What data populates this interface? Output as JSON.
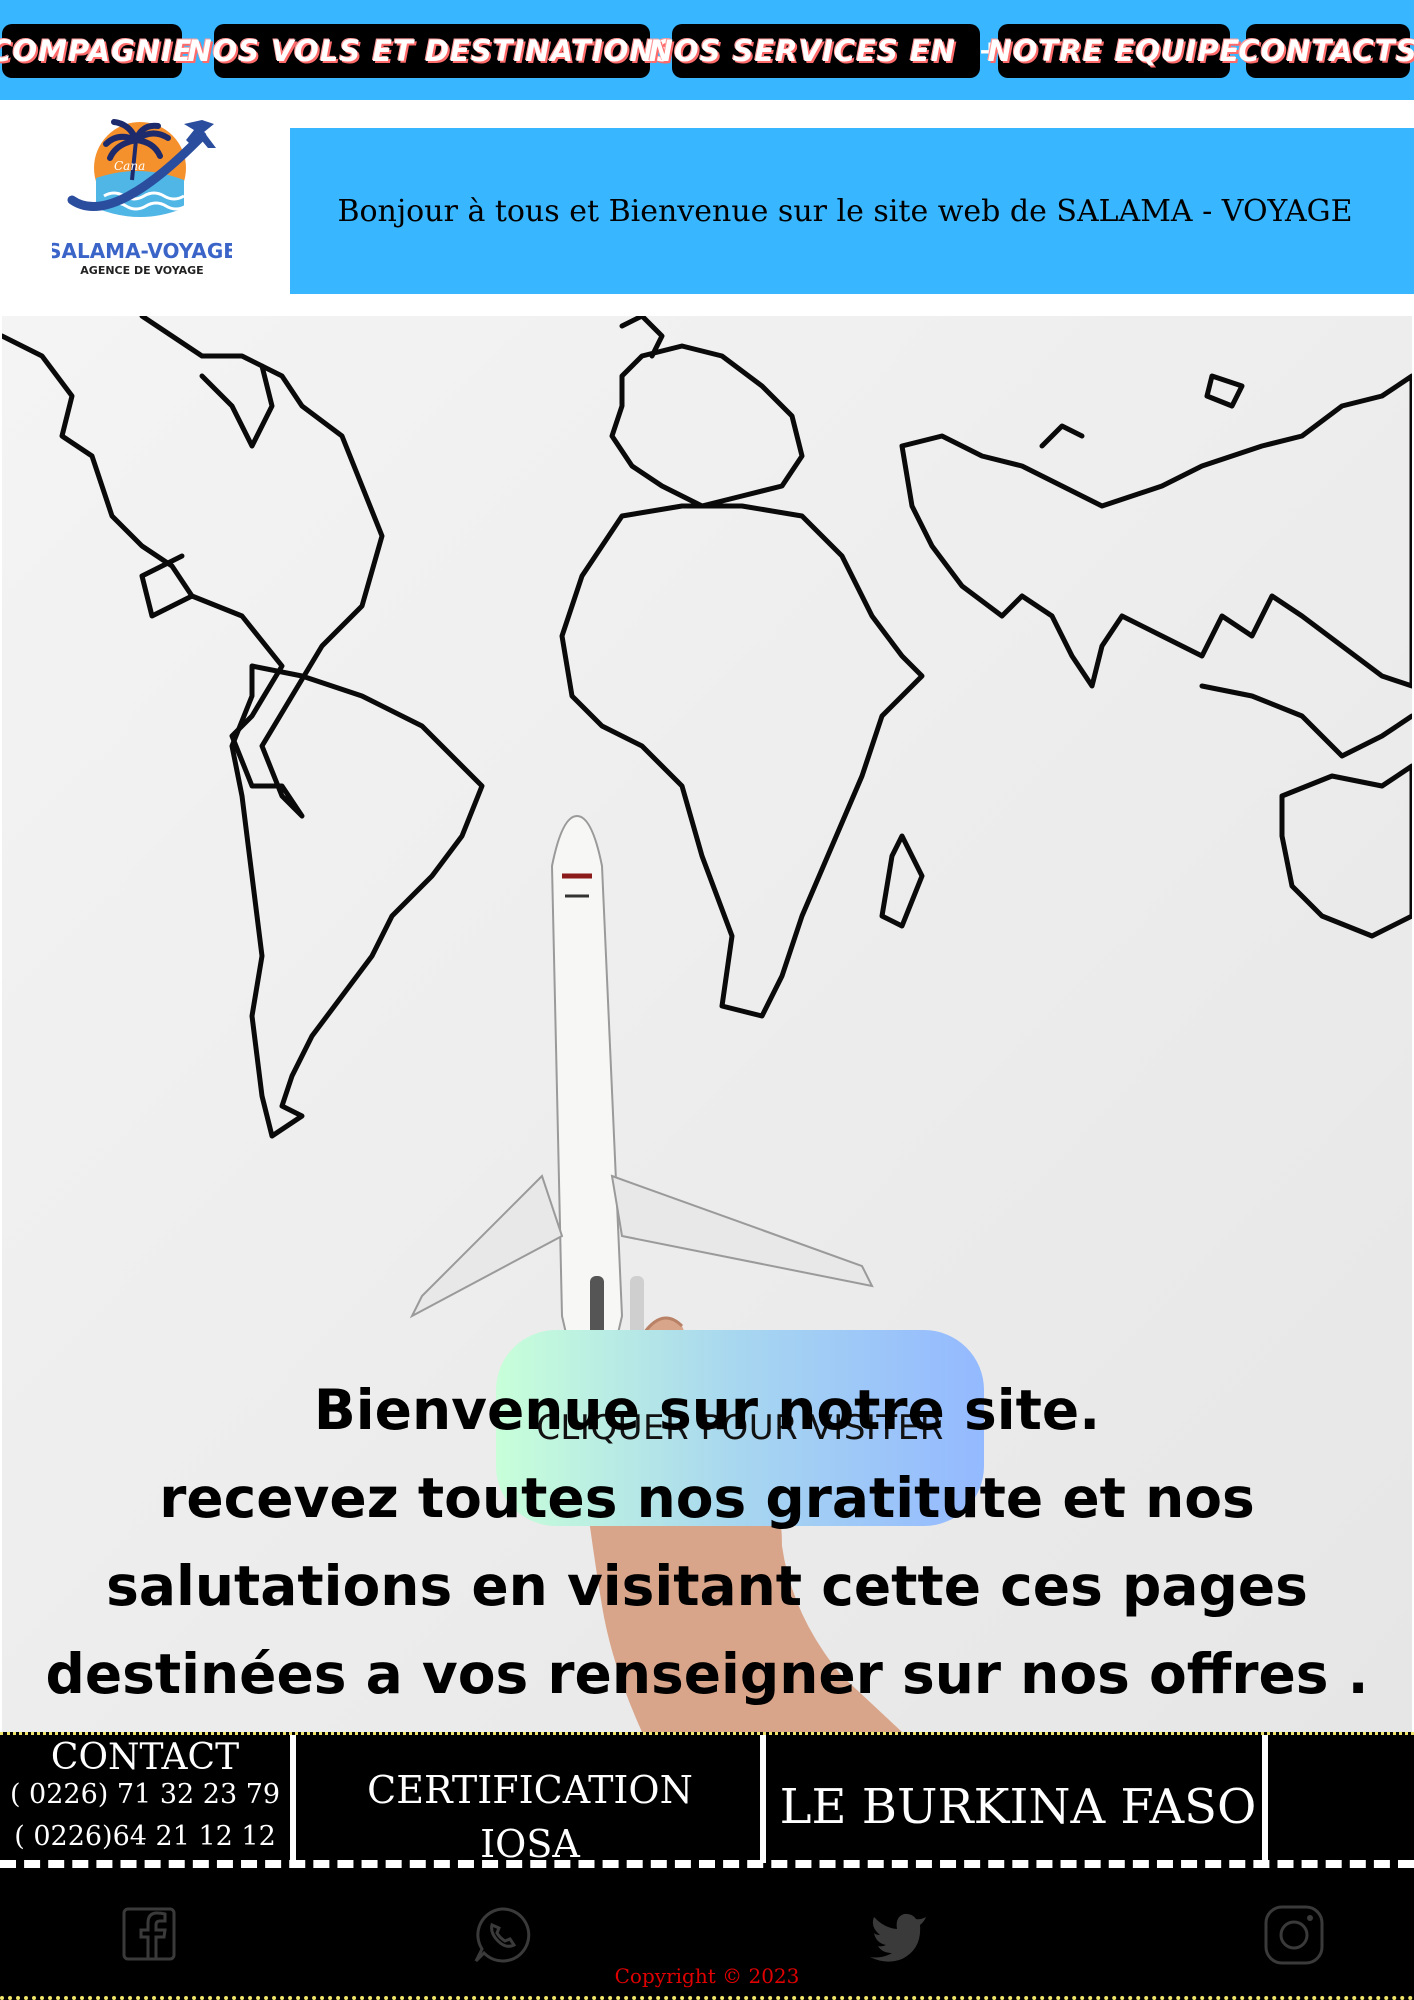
{
  "nav": {
    "items": [
      {
        "label": "Compagnie"
      },
      {
        "label": "Nos vols et destinations"
      },
      {
        "label": "Nos services en",
        "suffix": "+"
      },
      {
        "label": "Notre equipe"
      },
      {
        "label": "Contacts"
      }
    ]
  },
  "header": {
    "logo_text": "SALAMA-VOYAGE",
    "logo_subtext": "AGENCE DE VOYAGE",
    "logo_script": "Cana",
    "welcome": "Bonjour à tous et Bienvenue sur le site web de SALAMA - VOYAGE"
  },
  "hero": {
    "cta_label": "CLIQUER POUR VISITER",
    "lines": [
      "Bienvenue sur notre site.",
      "recevez toutes nos gratitute et nos",
      "salutations en visitant cette ces pages",
      "destinées a vos renseigner sur nos offres ."
    ]
  },
  "info": {
    "contact_title": "CONTACT",
    "phone1": "( 0226) 71 32 23 79",
    "phone2": "( 0226)64 21 12 12",
    "cert_line1": "CERTIFICATION",
    "cert_line2": "IOSA",
    "country": "LE BURKINA FASO"
  },
  "footer": {
    "icons": [
      "facebook-icon",
      "whatsapp-icon",
      "twitter-icon",
      "instagram-icon"
    ],
    "copyright": "Copyright © 2023"
  },
  "colors": {
    "nav_bg": "#38b6ff",
    "banner_bg": "#38b6ff",
    "copyright": "#e00000"
  }
}
